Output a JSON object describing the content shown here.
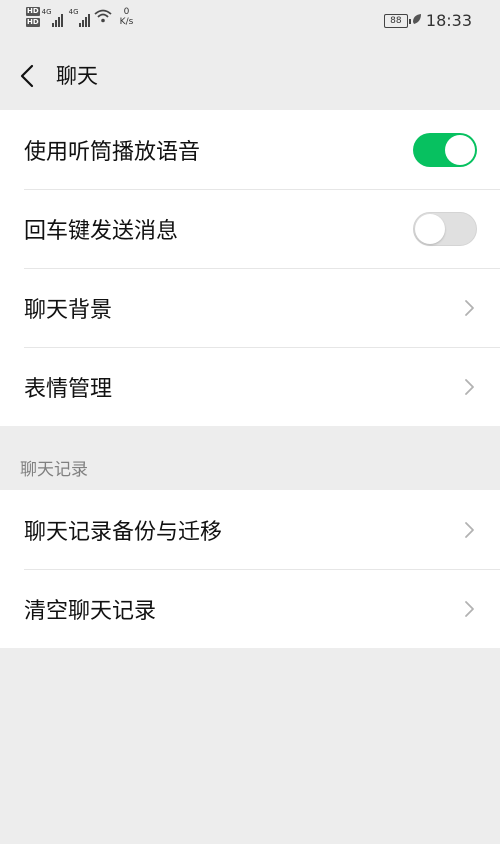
{
  "status_bar": {
    "hd1": "HD",
    "hd2": "HD",
    "sim1": "4G",
    "sim2": "4G",
    "net_speed_value": "0",
    "net_speed_unit": "K/s",
    "battery": "88",
    "time": "18:33"
  },
  "nav": {
    "title": "聊天"
  },
  "group1": {
    "items": [
      {
        "label": "使用听筒播放语音",
        "toggle": "on"
      },
      {
        "label": "回车键发送消息",
        "toggle": "off"
      },
      {
        "label": "聊天背景"
      },
      {
        "label": "表情管理"
      }
    ]
  },
  "section2": {
    "header": "聊天记录",
    "items": [
      {
        "label": "聊天记录备份与迁移"
      },
      {
        "label": "清空聊天记录"
      }
    ]
  },
  "colors": {
    "accent": "#07c160",
    "background": "#ededed",
    "secondary_text": "#808080"
  }
}
